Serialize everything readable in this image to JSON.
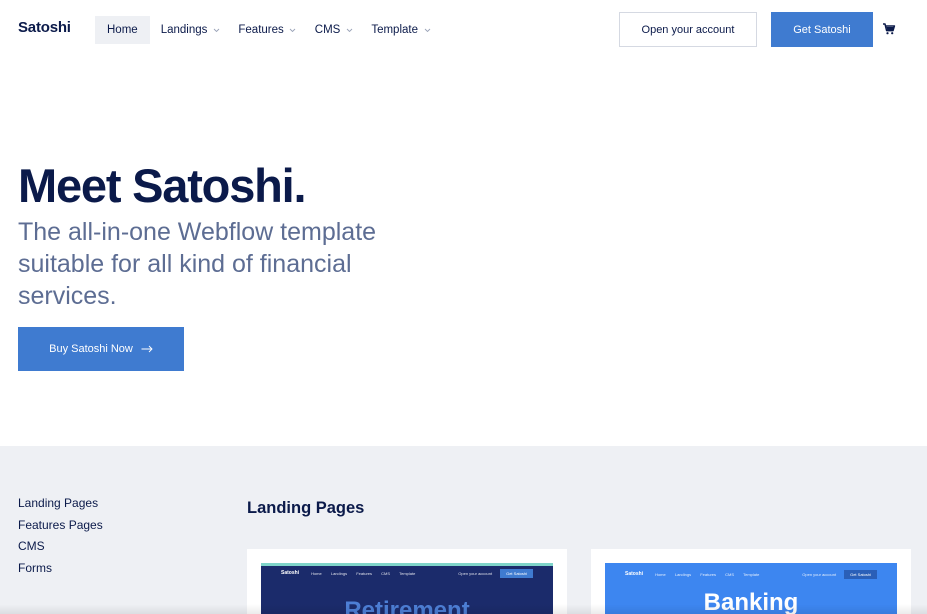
{
  "header": {
    "brand": "Satoshi",
    "nav": [
      {
        "label": "Home",
        "has_dropdown": false,
        "active": true
      },
      {
        "label": "Landings",
        "has_dropdown": true
      },
      {
        "label": "Features",
        "has_dropdown": true
      },
      {
        "label": "CMS",
        "has_dropdown": true
      },
      {
        "label": "Template",
        "has_dropdown": true
      }
    ],
    "open_account_label": "Open your account",
    "get_label": "Get Satoshi",
    "cart_icon": "cart-icon"
  },
  "hero": {
    "title": "Meet Satoshi.",
    "subtitle": "The all-in-one Webflow template suitable for all kind of financial services.",
    "cta_label": "Buy Satoshi Now",
    "cta_icon": "arrow-right-icon"
  },
  "lower": {
    "side_links": [
      "Landing Pages",
      "Features Pages",
      "CMS",
      "Forms"
    ],
    "section_title": "Landing Pages",
    "cards": [
      {
        "preview": {
          "brand": "Satoshi",
          "menu": [
            "Home",
            "Landings",
            "Features",
            "CMS",
            "Template"
          ],
          "open_label": "Open your account",
          "get_label": "Get Satoshi",
          "hero_text": "Retirement"
        }
      },
      {
        "preview": {
          "brand": "Satoshi",
          "menu": [
            "Home",
            "Landings",
            "Features",
            "CMS",
            "Template"
          ],
          "open_label": "Open your account",
          "get_label": "Get Satoshi",
          "hero_text": "Banking"
        }
      }
    ]
  },
  "colors": {
    "navy": "#0b1a4a",
    "accent_blue": "#3f7bd0",
    "subtitle_gray": "#5d6d93",
    "section_bg": "#eef0f4"
  }
}
